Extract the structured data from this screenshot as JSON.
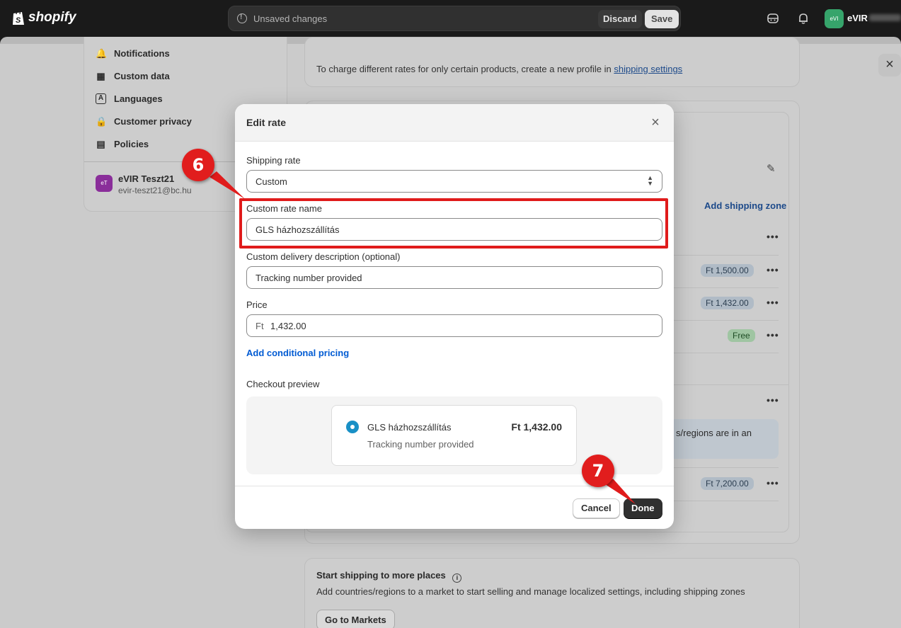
{
  "topbar": {
    "logo_text": "shopify",
    "unsaved_text": "Unsaved changes",
    "discard_label": "Discard",
    "save_label": "Save",
    "store_initials": "eVI",
    "store_name": "eVIR"
  },
  "settings_nav": {
    "items": [
      {
        "label": "Notifications",
        "icon": "bell-icon"
      },
      {
        "label": "Custom data",
        "icon": "custom-data-icon"
      },
      {
        "label": "Languages",
        "icon": "languages-icon"
      },
      {
        "label": "Customer privacy",
        "icon": "lock-icon"
      },
      {
        "label": "Policies",
        "icon": "policies-icon"
      }
    ],
    "store": {
      "initials": "eT",
      "name": "eVIR Teszt21",
      "email": "evir-teszt21@bc.hu"
    }
  },
  "background": {
    "profile_note": "To charge different rates for only certain products, create a new profile in",
    "profile_note_link": "shipping settings",
    "add_zone_link": "Add shipping zone",
    "badges": [
      "Ft 1,500.00",
      "Ft 1,432.00",
      "Free",
      "Ft 7,200.00"
    ],
    "note_fragment": "s/regions are in an",
    "more_places": {
      "title": "Start shipping to more places",
      "text": "Add countries/regions to a market to start selling and manage localized settings, including shipping zones",
      "button": "Go to Markets"
    }
  },
  "modal": {
    "title": "Edit rate",
    "shipping_rate_label": "Shipping rate",
    "shipping_rate_value": "Custom",
    "rate_name_label": "Custom rate name",
    "rate_name_value": "GLS házhozszállítás",
    "description_label": "Custom delivery description (optional)",
    "description_value": "Tracking number provided",
    "price_label": "Price",
    "price_prefix": "Ft",
    "price_value": "1,432.00",
    "conditional_link": "Add conditional pricing",
    "preview_label": "Checkout preview",
    "preview": {
      "name": "GLS házhozszállítás",
      "price": "Ft 1,432.00",
      "description": "Tracking number provided"
    },
    "cancel_label": "Cancel",
    "done_label": "Done"
  },
  "annotations": {
    "step_a": "6",
    "step_b": "7",
    "color": "#e01b1b"
  }
}
